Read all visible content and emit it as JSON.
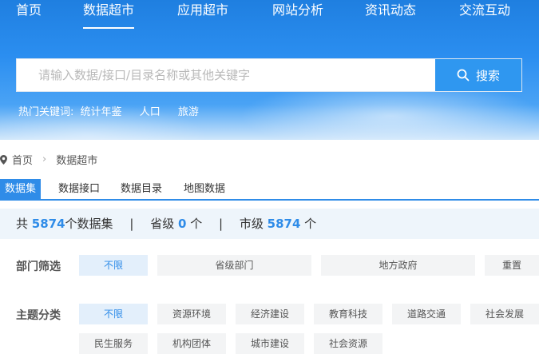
{
  "nav": {
    "items": [
      {
        "label": "首页"
      },
      {
        "label": "数据超市"
      },
      {
        "label": "应用超市"
      },
      {
        "label": "网站分析"
      },
      {
        "label": "资讯动态"
      },
      {
        "label": "交流互动"
      }
    ],
    "active": "数据超市"
  },
  "search": {
    "placeholder": "请输入数据/接口/目录名称或其他关键字",
    "value": "",
    "button_label": "搜索"
  },
  "hot": {
    "label": "热门关键词:",
    "keywords": [
      "统计年鉴",
      "人口",
      "旅游"
    ]
  },
  "breadcrumb": {
    "home": "首页",
    "current": "数据超市"
  },
  "tabs": [
    {
      "label": "数据集"
    },
    {
      "label": "数据接口"
    },
    {
      "label": "数据目录"
    },
    {
      "label": "地图数据"
    }
  ],
  "active_tab": "数据集",
  "stats": {
    "total_prefix": "共",
    "total": "5874",
    "total_suffix": "个数据集",
    "sep": "|",
    "province_prefix": "省级",
    "province": "0",
    "province_suffix": "个",
    "city_prefix": "市级",
    "city": "5874",
    "city_suffix": "个"
  },
  "filters": {
    "department": {
      "label": "部门筛选",
      "options": [
        "不限",
        "省级部门",
        "地方政府",
        "重置"
      ]
    },
    "topic": {
      "label": "主题分类",
      "options": [
        "不限",
        "资源环境",
        "经济建设",
        "教育科技",
        "道路交通",
        "社会发展",
        "民生服务",
        "机构团体",
        "城市建设",
        "社会资源"
      ]
    }
  },
  "colors": {
    "accent": "#2f8ce8",
    "hero_top": "#1f7fe0",
    "search_button": "#2f97f0"
  }
}
